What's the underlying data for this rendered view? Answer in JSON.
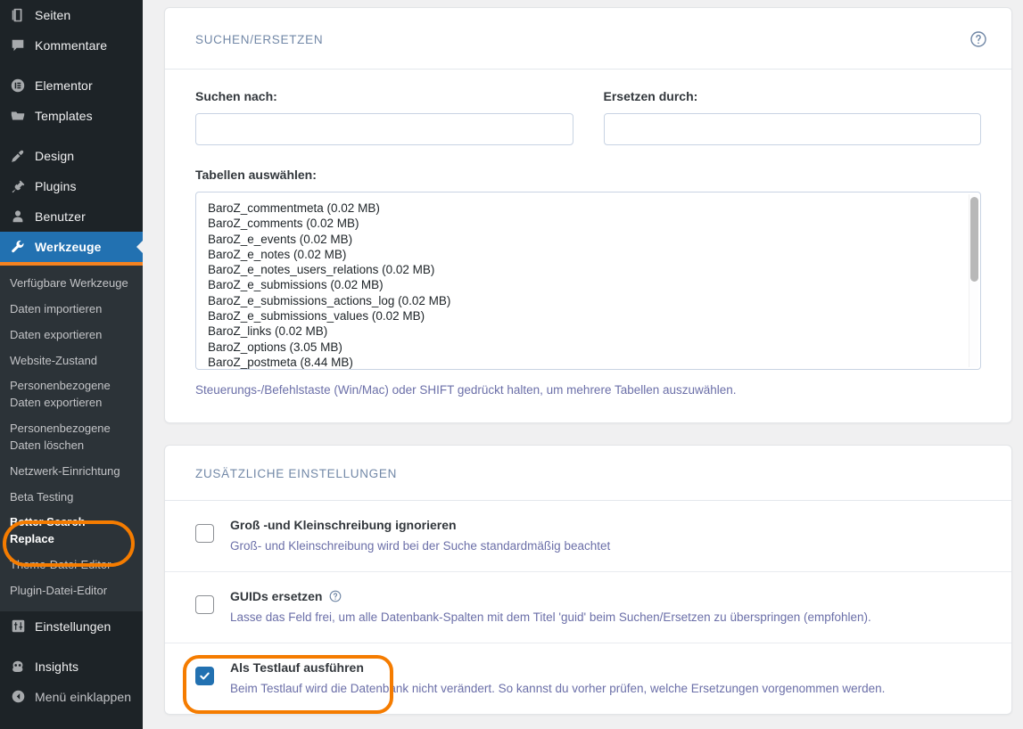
{
  "sidebar": {
    "top_items": [
      {
        "label": "Seiten",
        "icon": "pages-icon",
        "current": false,
        "gap_after": false
      },
      {
        "label": "Kommentare",
        "icon": "comments-icon",
        "current": false,
        "gap_after": true
      },
      {
        "label": "Elementor",
        "icon": "elementor-icon",
        "current": false,
        "gap_after": false
      },
      {
        "label": "Templates",
        "icon": "folder-icon",
        "current": false,
        "gap_after": true
      },
      {
        "label": "Design",
        "icon": "appearance-icon",
        "current": false,
        "gap_after": false
      },
      {
        "label": "Plugins",
        "icon": "plugins-icon",
        "current": false,
        "gap_after": false
      },
      {
        "label": "Benutzer",
        "icon": "users-icon",
        "current": false,
        "gap_after": false
      },
      {
        "label": "Werkzeuge",
        "icon": "tools-icon",
        "current": true,
        "gap_after": false
      }
    ],
    "submenu_items": [
      {
        "label": "Verfügbare Werkzeuge",
        "current": false
      },
      {
        "label": "Daten importieren",
        "current": false
      },
      {
        "label": "Daten exportieren",
        "current": false
      },
      {
        "label": "Website-Zustand",
        "current": false
      },
      {
        "label": "Personenbezogene Daten exportieren",
        "current": false
      },
      {
        "label": "Personenbezogene Daten löschen",
        "current": false
      },
      {
        "label": "Netzwerk-Einrichtung",
        "current": false
      },
      {
        "label": "Beta Testing",
        "current": false
      },
      {
        "label": "Better Search Replace",
        "current": true
      },
      {
        "label": "Theme-Datei-Editor",
        "current": false
      },
      {
        "label": "Plugin-Datei-Editor",
        "current": false
      }
    ],
    "bottom_items": [
      {
        "label": "Einstellungen",
        "icon": "settings-icon"
      },
      {
        "label": "Insights",
        "icon": "insights-icon"
      }
    ],
    "collapse_label": "Menü einklappen",
    "collapse_icon": "collapse-arrow-icon",
    "colors": {
      "background": "#1d2327",
      "submenu_background": "#2c3338",
      "current_item": "#2271b1",
      "current_underline": "#f58220",
      "annotation_ring": "#f57c00"
    }
  },
  "search_replace_card": {
    "title": "SUCHEN/ERSETZEN",
    "help_icon": "help-circle-icon",
    "search_label": "Suchen nach:",
    "search_value": "",
    "search_placeholder": "",
    "replace_label": "Ersetzen durch:",
    "replace_value": "",
    "replace_placeholder": "",
    "tables_label": "Tabellen auswählen:",
    "tables": [
      "BaroZ_commentmeta (0.02 MB)",
      "BaroZ_comments (0.02 MB)",
      "BaroZ_e_events (0.02 MB)",
      "BaroZ_e_notes (0.02 MB)",
      "BaroZ_e_notes_users_relations (0.02 MB)",
      "BaroZ_e_submissions (0.02 MB)",
      "BaroZ_e_submissions_actions_log (0.02 MB)",
      "BaroZ_e_submissions_values (0.02 MB)",
      "BaroZ_links (0.02 MB)",
      "BaroZ_options (3.05 MB)",
      "BaroZ_postmeta (8.44 MB)"
    ],
    "tables_hint": "Steuerungs-/Befehlstaste (Win/Mac) oder SHIFT gedrückt halten, um mehrere Tabellen auszuwählen."
  },
  "additional_settings_card": {
    "title": "ZUSÄTZLICHE EINSTELLUNGEN",
    "rows": [
      {
        "title": "Groß -und Kleinschreibung ignorieren",
        "description": "Groß- und Kleinschreibung wird bei der Suche standardmäßig beachtet",
        "checked": false,
        "has_help": false
      },
      {
        "title": "GUIDs ersetzen",
        "description": "Lasse das Feld frei, um alle Datenbank-Spalten mit dem Titel 'guid' beim Suchen/Ersetzen zu überspringen (empfohlen).",
        "checked": false,
        "has_help": true,
        "help_icon": "help-circle-icon"
      },
      {
        "title": "Als Testlauf ausführen",
        "description": "Beim Testlauf wird die Datenbank nicht verändert. So kannst du vorher prüfen, welche Ersetzungen vorgenommen werden.",
        "checked": true,
        "has_help": false
      }
    ]
  }
}
